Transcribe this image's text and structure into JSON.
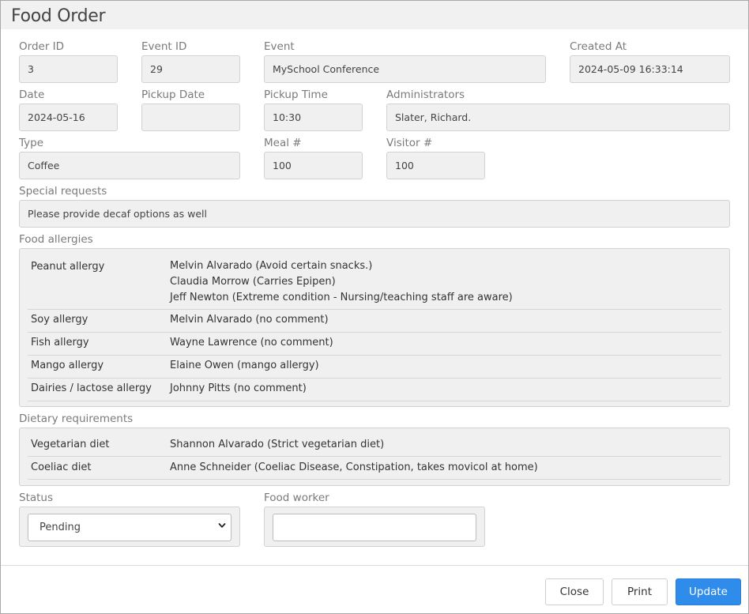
{
  "dialog": {
    "title": "Food Order"
  },
  "fields": {
    "order_id": {
      "label": "Order ID",
      "value": "3"
    },
    "event_id": {
      "label": "Event ID",
      "value": "29"
    },
    "event": {
      "label": "Event",
      "value": "MySchool Conference"
    },
    "created_at": {
      "label": "Created At",
      "value": "2024-05-09 16:33:14"
    },
    "date": {
      "label": "Date",
      "value": "2024-05-16"
    },
    "pickup_date": {
      "label": "Pickup Date",
      "value": ""
    },
    "pickup_time": {
      "label": "Pickup Time",
      "value": "10:30"
    },
    "administrators": {
      "label": "Administrators",
      "value": "Slater, Richard."
    },
    "type": {
      "label": "Type",
      "value": "Coffee"
    },
    "meal_count": {
      "label": "Meal #",
      "value": "100"
    },
    "visitor_count": {
      "label": "Visitor #",
      "value": "100"
    },
    "special_requests": {
      "label": "Special requests",
      "value": "Please provide decaf options as well"
    }
  },
  "food_allergies": {
    "label": "Food allergies",
    "rows": [
      {
        "name": "Peanut allergy",
        "people": [
          "Melvin Alvarado (Avoid certain snacks.)",
          "Claudia Morrow (Carries Epipen)",
          "Jeff Newton (Extreme condition - Nursing/teaching staff are aware)"
        ]
      },
      {
        "name": "Soy allergy",
        "people": [
          "Melvin Alvarado (no comment)"
        ]
      },
      {
        "name": "Fish allergy",
        "people": [
          "Wayne Lawrence (no comment)"
        ]
      },
      {
        "name": "Mango allergy",
        "people": [
          "Elaine Owen (mango allergy)"
        ]
      },
      {
        "name": "Dairies / lactose allergy",
        "people": [
          "Johnny Pitts (no comment)"
        ]
      }
    ]
  },
  "dietary_requirements": {
    "label": "Dietary requirements",
    "rows": [
      {
        "name": "Vegetarian diet",
        "people": [
          "Shannon Alvarado (Strict vegetarian diet)"
        ]
      },
      {
        "name": "Coeliac diet",
        "people": [
          "Anne Schneider (Coeliac Disease, Constipation, takes movicol at home)"
        ]
      }
    ]
  },
  "status": {
    "label": "Status",
    "selected": "Pending"
  },
  "food_worker": {
    "label": "Food worker",
    "value": ""
  },
  "buttons": {
    "close": "Close",
    "print": "Print",
    "update": "Update"
  },
  "colors": {
    "primary": "#2f8ceb",
    "panel_bg": "#f0f0f0"
  },
  "icons": {
    "status_select": "chevron-down-icon"
  }
}
